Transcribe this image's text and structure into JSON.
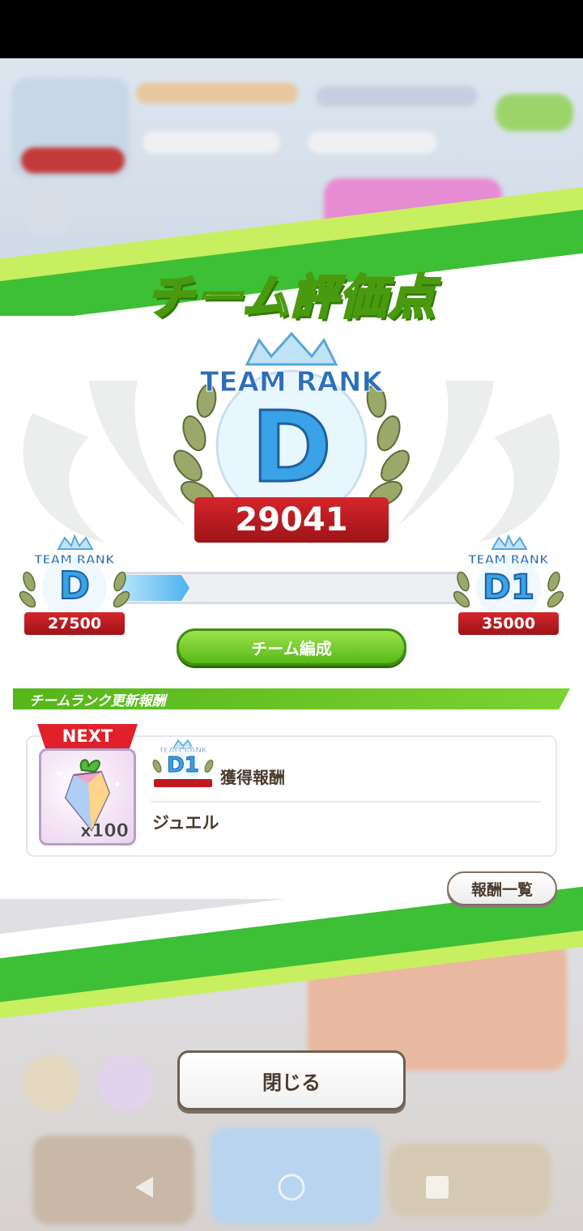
{
  "modal": {
    "title": "チーム評価点",
    "current_rank": {
      "header": "TEAM RANK",
      "letter": "D",
      "score": "29041"
    },
    "progress": {
      "from": {
        "header": "TEAM RANK",
        "letter": "D",
        "score": "27500"
      },
      "to": {
        "header": "TEAM RANK",
        "letter": "D1",
        "score": "35000"
      },
      "fraction": 0.2
    },
    "team_edit_button": "チーム編成",
    "section_title": "チームランク更新報酬",
    "next_reward": {
      "tag": "NEXT",
      "rank_header": "TEAM RANK",
      "rank_letter": "D1",
      "label": "獲得報酬",
      "item_name": "ジュエル",
      "item_count": "x100"
    },
    "reward_list_button": "報酬一覧",
    "close_button": "閉じる"
  },
  "colors": {
    "accent_green": "#58b819",
    "ribbon_red": "#c0181f",
    "rank_blue": "#2d6fb8",
    "next_red": "#e0202a"
  },
  "nav": {
    "icons": [
      "back-icon",
      "home-icon",
      "recents-icon"
    ]
  }
}
